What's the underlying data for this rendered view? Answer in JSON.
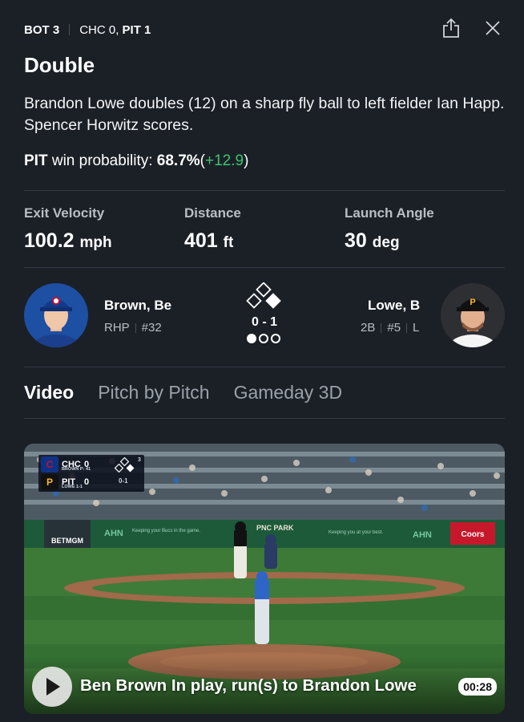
{
  "header": {
    "inning": "BOT 3",
    "away_score": "CHC 0,",
    "home_score": "PIT 1"
  },
  "play": {
    "title": "Double",
    "description": "Brandon Lowe doubles (12) on a sharp fly ball to left fielder Ian Happ. Spencer Horwitz scores.",
    "win_prob_team": "PIT",
    "win_prob_label": "win probability:",
    "win_prob_value": "68.7%",
    "win_prob_delta_open": "(",
    "win_prob_delta": "+12.9",
    "win_prob_delta_close": ")"
  },
  "stats": [
    {
      "label": "Exit Velocity",
      "value": "100.2",
      "unit": "mph"
    },
    {
      "label": "Distance",
      "value": "401",
      "unit": "ft"
    },
    {
      "label": "Launch Angle",
      "value": "30",
      "unit": "deg"
    }
  ],
  "matchup": {
    "pitcher": {
      "name": "Brown, Be",
      "position": "RHP",
      "number": "#32"
    },
    "batter": {
      "name": "Lowe, B",
      "position": "2B",
      "number": "#5",
      "bats": "L"
    },
    "count": "0 - 1",
    "outs": 1,
    "bases": {
      "first": true,
      "second": false,
      "third": false
    }
  },
  "tabs": [
    {
      "label": "Video",
      "active": true
    },
    {
      "label": "Pitch by Pitch",
      "active": false
    },
    {
      "label": "Gameday 3D",
      "active": false
    }
  ],
  "video": {
    "title": "Ben Brown In play, run(s) to Brandon Lowe",
    "duration": "00:28",
    "bug": {
      "away": "CHC",
      "away_runs": "0",
      "pitcher": "BROWN P: 41",
      "home": "PIT",
      "home_runs": "0",
      "batter": "LOWE 1-1",
      "count": "0-1",
      "inning": "3"
    },
    "signs": [
      "AHN",
      "Keeping your Bucs in the game.",
      "PNC PARK",
      "Keeping you at your best.",
      "AHN",
      "BETMGM",
      "Coors"
    ]
  },
  "colors": {
    "background": "#1b2027",
    "positive": "#3ec46d",
    "muted_text": "#b8bec6",
    "cubs_blue": "#0e3386",
    "pirates_gold": "#fdb827"
  }
}
